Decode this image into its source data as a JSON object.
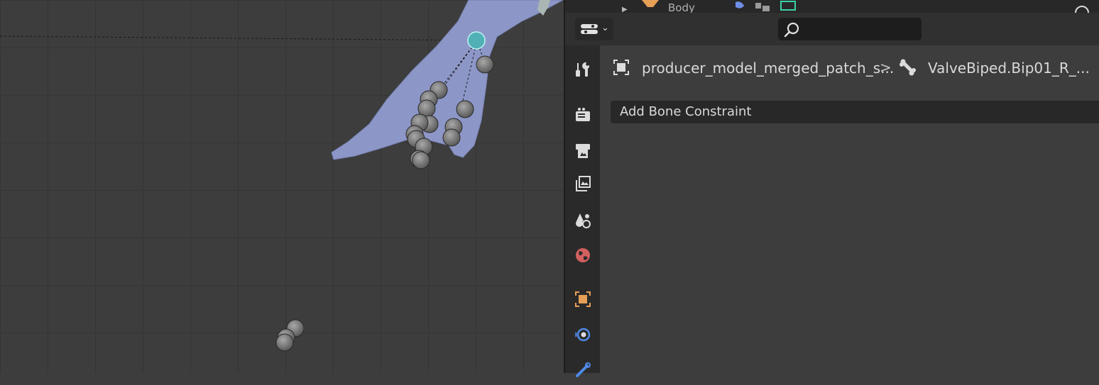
{
  "outliner": {
    "partial_text": "Body"
  },
  "properties": {
    "editor_type_icon": "properties-editor-icon",
    "search": {
      "placeholder": "",
      "value": ""
    },
    "tabs": [
      {
        "name": "tool",
        "icon": "tool-icon",
        "active": false
      },
      {
        "name": "render",
        "icon": "render-icon",
        "active": false
      },
      {
        "name": "output",
        "icon": "output-icon",
        "active": false
      },
      {
        "name": "view-layer",
        "icon": "view-layer-icon",
        "active": false
      },
      {
        "name": "scene",
        "icon": "scene-icon",
        "active": false
      },
      {
        "name": "world",
        "icon": "world-icon",
        "active": false
      },
      {
        "name": "object",
        "icon": "object-icon",
        "active": false
      },
      {
        "name": "physics",
        "icon": "physics-icon",
        "active": false
      },
      {
        "name": "bone-constraint",
        "icon": "bone-constraint-icon",
        "active": false
      }
    ],
    "breadcrumb": {
      "object_name": "producer_model_merged_patch_s...",
      "separator": ">",
      "bone_name": "ValveBiped.Bip01_R_..."
    },
    "add_constraint_label": "Add Bone Constraint"
  },
  "colors": {
    "accent_object": "#e69f56",
    "accent_world": "#d26060",
    "accent_physics": "#4f8ae6",
    "mesh": "#8d97c7",
    "active_joint": "#4fb0b5"
  }
}
